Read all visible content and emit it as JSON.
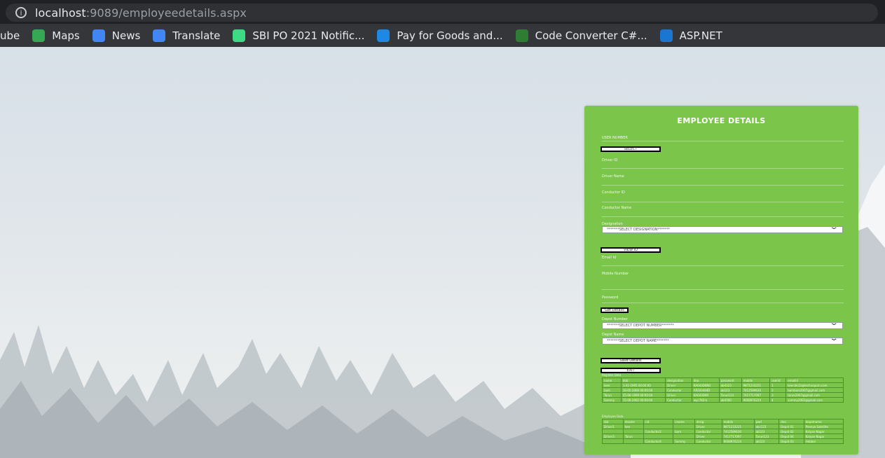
{
  "browser": {
    "url_host": "localhost",
    "url_rest": ":9089/employeedetails.aspx",
    "bookmarks": [
      {
        "label": "ube",
        "icon": "none",
        "color": "#35363a"
      },
      {
        "label": "Maps",
        "icon": "maps-icon",
        "color": "#34a853"
      },
      {
        "label": "News",
        "icon": "news-icon",
        "color": "#4285f4"
      },
      {
        "label": "Translate",
        "icon": "translate-icon",
        "color": "#4285f4"
      },
      {
        "label": "SBI PO 2021 Notific...",
        "icon": "sbi-icon",
        "color": "#3ddc84"
      },
      {
        "label": "Pay for Goods and...",
        "icon": "paypal-icon",
        "color": "#1e88e5"
      },
      {
        "label": "Code Converter C#...",
        "icon": "code-converter-icon",
        "color": "#2e7d32"
      },
      {
        "label": "ASP.NET",
        "icon": "asp-icon",
        "color": "#1976d2"
      }
    ]
  },
  "form": {
    "title": "EMPLOYEE DETAILS",
    "user_number_label": "USER NUMBER",
    "select_button": "SELECT",
    "driver_id_label": "Driver ID",
    "driver_name_label": "Driver Name",
    "conductor_id_label": "Conductor ID",
    "conductor_name_label": "Conductor Name",
    "designation_label": "Designation",
    "designation_value": "*******SELECT DESIGNATION*******",
    "view_button": "VIEW ID",
    "email_label": "Email Id",
    "mobile_label": "Mobile Number",
    "password_label": "Password",
    "get_details_button": "Get Details",
    "depot_number_label": "Depot Number",
    "depot_number_value": "*******SELECT DEPOT NUMBER*******",
    "depot_name_label": "Depot Name",
    "depot_name_value": "*******SELECT DEPOT NAME*******",
    "save_button": "Save Details",
    "exit_button": "EXIT"
  },
  "register_caption": "Register Data",
  "register_table": [
    [
      "name",
      "dob",
      "designation",
      "dno",
      "password",
      "mobile",
      "userid",
      "emailid"
    ],
    [
      "keer",
      "1-01-1995 00:00:00",
      "Driver",
      "KA043D6N0",
      "ab4323",
      "9871233221",
      "1",
      "keer.bk33@technopurn.com"
    ],
    [
      "bam",
      "10-05-2000 00:00:00",
      "Conductor",
      "AP203484D",
      "ab123",
      "7412589630",
      "2",
      "bambam2007@gmail.com"
    ],
    [
      "Tarun",
      "25-06-1999 00:00:00",
      "Driver",
      "KA043D99",
      "Tarun123",
      "7417717097",
      "3",
      "tarun2007@gmail.com"
    ],
    [
      "Sommy",
      "15-06-2002 00:00:00",
      "Conductor",
      "wyc7K0-k",
      "ab4300",
      "9008970224",
      "4",
      "sommy2002@gmail.com"
    ]
  ],
  "employee_caption": "Employee Data",
  "employee_table": [
    [
      "did",
      "dname",
      "cid",
      "cname",
      "desig",
      "mobile",
      "pwd",
      "dno",
      "depotname"
    ],
    [
      "Driver1",
      "kee",
      "",
      "",
      "Driver",
      "9871233221",
      "abc123",
      "Depot 01",
      "Peenya Satellite"
    ],
    [
      "",
      "",
      "Conductor2",
      "bam",
      "Conductor",
      "7412589630",
      "ab123",
      "Depot 02",
      "Kalyan Nagar"
    ],
    [
      "Driver3",
      "Tarun",
      "",
      "",
      "Driver",
      "7417717097",
      "Tarun123",
      "Depot 04",
      "Kalyan Nagar"
    ],
    [
      "",
      "",
      "Conductor4",
      "Sommy",
      "Conductor",
      "9008970224",
      "ab123",
      "Depot 03",
      "Hebbal"
    ]
  ]
}
